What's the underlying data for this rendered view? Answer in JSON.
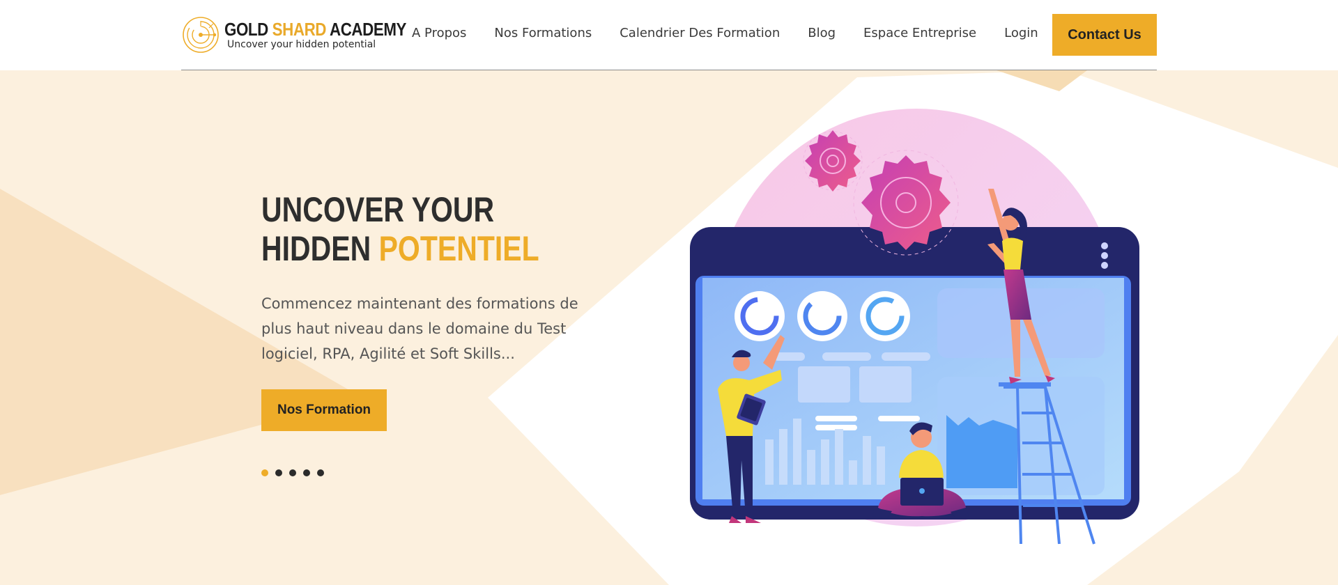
{
  "header": {
    "logo": {
      "title_part1": "GOLD",
      "title_part2": "SHARD",
      "title_part3": "ACADEMY",
      "tagline": "Uncover  your hidden potential"
    },
    "nav": [
      "A Propos",
      "Nos Formations",
      "Calendrier Des Formation",
      "Blog",
      "Espace Entreprise",
      "Login"
    ],
    "contact_label": "Contact Us"
  },
  "hero": {
    "title_line1": "UNCOVER YOUR",
    "title_line2_plain": "HIDDEN",
    "title_line2_accent": "POTENTIEL",
    "description": "Commencez maintenant des formations de plus haut niveau dans le domaine du Test logiciel, RPA, Agilité et Soft Skills...",
    "button_label": "Nos Formation",
    "slider": {
      "count": 5,
      "active_index": 0
    },
    "illustration": "team-dashboard-illustration"
  },
  "colors": {
    "accent": "#eeac28",
    "hero_bg": "#fcf0de",
    "hero_band": "#f8e2c3",
    "dark_text": "#2e2e2e",
    "screen_frame": "#23266a",
    "gear": "#d6409f"
  },
  "icons": [
    "logo-mark-icon"
  ]
}
